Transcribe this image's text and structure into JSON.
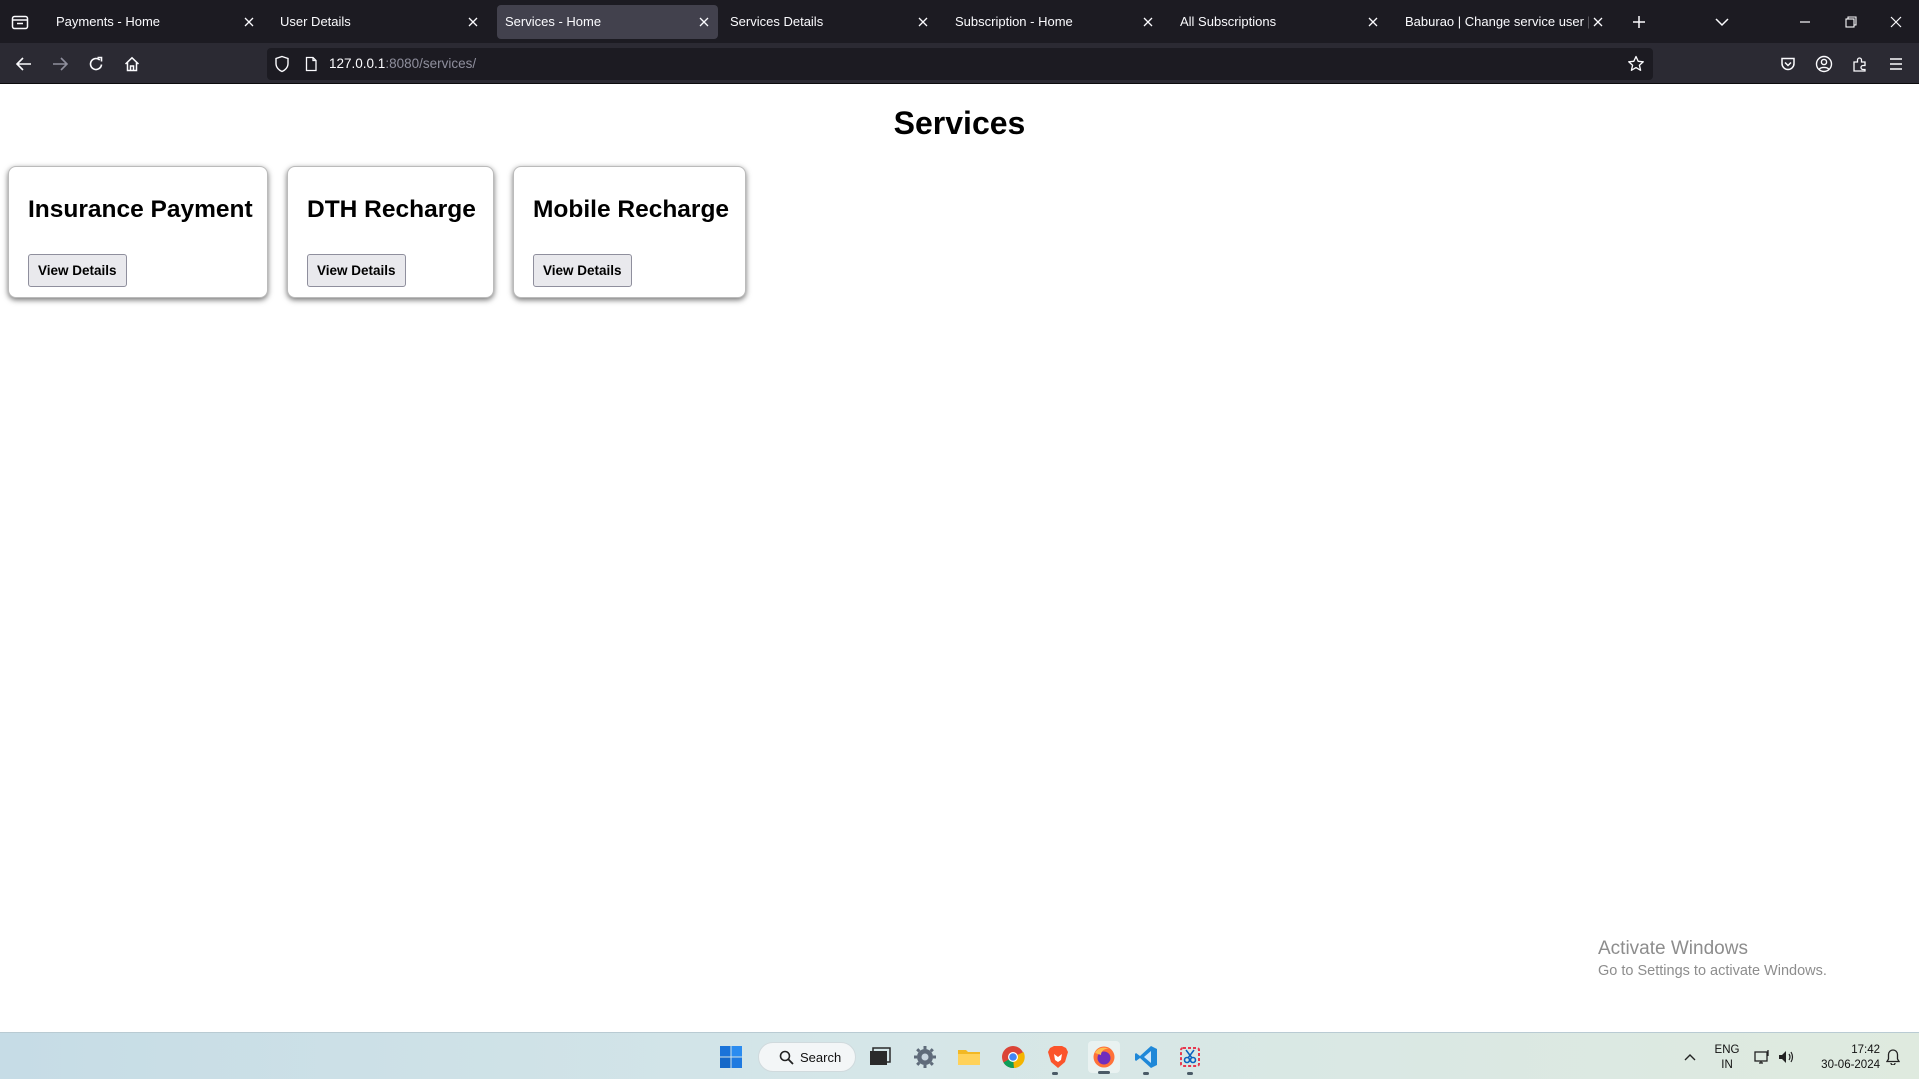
{
  "browser": {
    "tabs": [
      {
        "title": "Payments - Home",
        "active": false
      },
      {
        "title": "User Details",
        "active": false
      },
      {
        "title": "Services - Home",
        "active": true
      },
      {
        "title": "Services Details",
        "active": false
      },
      {
        "title": "Subscription - Home",
        "active": false
      },
      {
        "title": "All Subscriptions",
        "active": false
      },
      {
        "title": "Baburao | Change service user | Djan",
        "active": false
      }
    ],
    "url": {
      "host": "127.0.0.1",
      "rest": ":8080/services/"
    }
  },
  "page": {
    "title": "Services",
    "services": [
      {
        "name": "Insurance Payment",
        "button": "View Details"
      },
      {
        "name": "DTH Recharge",
        "button": "View Details"
      },
      {
        "name": "Mobile Recharge",
        "button": "View Details"
      }
    ]
  },
  "watermark": {
    "title": "Activate Windows",
    "subtitle": "Go to Settings to activate Windows."
  },
  "taskbar": {
    "search_label": "Search",
    "language_line1": "ENG",
    "language_line2": "IN",
    "time": "17:42",
    "date": "30-06-2024"
  },
  "colors": {
    "tabstrip": "#1c1b22",
    "active_tab": "#42414d",
    "navbar": "#2b2a33"
  }
}
